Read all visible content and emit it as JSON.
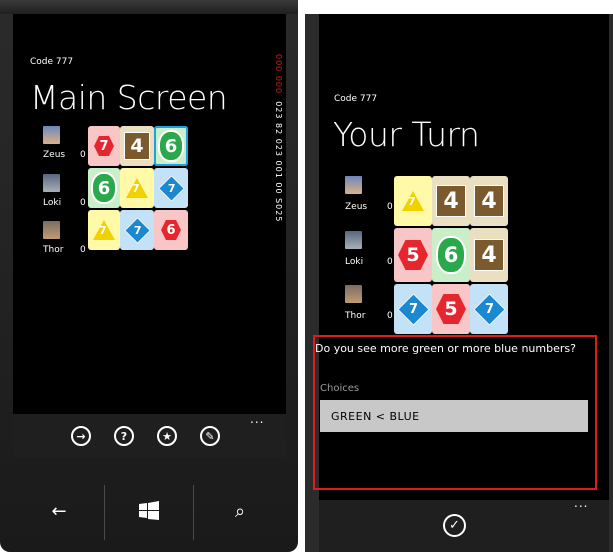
{
  "app_name": "Code 777",
  "left": {
    "title": "Main Screen",
    "code_red": "000 000",
    "code_white": "023 82 023 001 00 S025",
    "players": [
      {
        "name": "Zeus",
        "score": "0"
      },
      {
        "name": "Loki",
        "score": "0"
      },
      {
        "name": "Thor",
        "score": "0"
      }
    ],
    "tiles": [
      [
        "7",
        "4",
        "6"
      ],
      [
        "6",
        "7",
        "7"
      ],
      [
        "7",
        "7",
        "6"
      ]
    ],
    "appbar": {
      "next_glyph": "→",
      "help_glyph": "?",
      "star_glyph": "★",
      "edit_glyph": "✎",
      "more": "..."
    },
    "hardware": {
      "back": "←",
      "search": "⌕"
    }
  },
  "right": {
    "title": "Your Turn",
    "players": [
      {
        "name": "Zeus",
        "score": "0"
      },
      {
        "name": "Loki",
        "score": "0"
      },
      {
        "name": "Thor",
        "score": "0"
      }
    ],
    "tiles": [
      [
        "7",
        "4",
        "4"
      ],
      [
        "5",
        "6",
        "4"
      ],
      [
        "7",
        "5",
        "7"
      ]
    ],
    "question": "Do you see more green or more blue numbers?",
    "choices_label": "Choices",
    "choice_value": "GREEN  <  BLUE",
    "appbar": {
      "confirm_glyph": "✓",
      "more": "..."
    }
  },
  "colors": {
    "accent_red": "#e01b1b",
    "tile_select": "#1ba0e0"
  }
}
